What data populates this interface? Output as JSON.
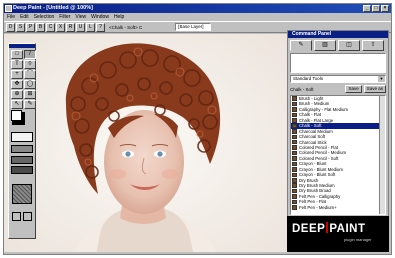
{
  "window": {
    "title": "Deep Paint - [Untitled @ 100%]",
    "buttons": [
      "_",
      "□",
      "×"
    ]
  },
  "menu": [
    "File",
    "Edit",
    "Selection",
    "Filter",
    "View",
    "Window",
    "Help"
  ],
  "toolbar": {
    "buttons": [
      "D",
      "S",
      "P",
      "B",
      "C",
      "X",
      "R",
      "U",
      "L",
      "?"
    ],
    "brush_field": "<Chalk - Soft> C",
    "layer_field": "[Base Layer]"
  },
  "tools": {
    "items": [
      "□",
      "/",
      "T",
      "◊",
      "+",
      "⌒",
      "✥",
      "◯",
      "⊕",
      "⊞",
      "↖",
      "✎"
    ],
    "swatches": {
      "fg": "#ffffff",
      "bg": "#000000"
    }
  },
  "command_panel": {
    "title": "Command Panel",
    "tabs": [
      "✎",
      "▥",
      "◫",
      "⇧"
    ],
    "preset_select": "Standard Tools",
    "category_label": "Chalk - Soft",
    "save_button": "Save",
    "save_as_button": "Save as",
    "presets": [
      "Brush - Light",
      "Brush - Medium",
      "Calligraphy - Flat Medium",
      "Chalk - Flat",
      "Chalk - Flat Large",
      "Chalk - Soft",
      "Charcoal Medium",
      "Charcoal Soft",
      "Charcoal Stick",
      "Colored Pencil - Flat",
      "Colored Pencil - Medium",
      "Colored Pencil - Soft",
      "Crayon - Blunt",
      "Crayon - Blunt Medium",
      "Crayon - Blunt Soft",
      "Dry Brush",
      "Dry Brush Medium",
      "Dry Brush Broad",
      "Felt Pen - Calligraphy",
      "Felt Pen - Flat",
      "Felt Pen - Medium+"
    ],
    "selected_index": 5
  },
  "logo": {
    "part1": "DEEP",
    "part2": "PAINT",
    "sub": "plugin manager"
  },
  "colors": {
    "titlebar": "#0a1f85",
    "chrome": "#c0c0c0",
    "hair": "#8a3a1c",
    "logo_bar": "#cc0000"
  }
}
